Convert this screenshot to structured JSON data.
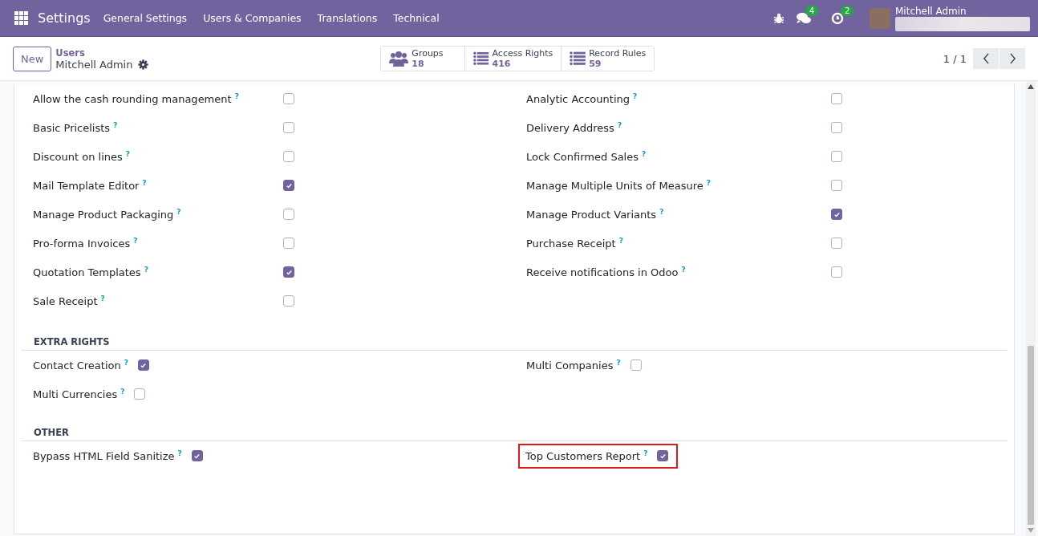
{
  "navbar": {
    "app": "Settings",
    "menu": [
      "General Settings",
      "Users & Companies",
      "Translations",
      "Technical"
    ],
    "messages_badge": "4",
    "activities_badge": "2",
    "user": "Mitchell Admin"
  },
  "control_panel": {
    "new_button": "New",
    "breadcrumb": "Users",
    "record": "Mitchell Admin",
    "pager": "1 / 1",
    "smart_buttons": [
      {
        "kind": "groups",
        "label": "Groups",
        "count": "18"
      },
      {
        "kind": "list",
        "label": "Access Rights",
        "count": "416"
      },
      {
        "kind": "list",
        "label": "Record Rules",
        "count": "59"
      }
    ]
  },
  "sections": [
    {
      "kind": "wide",
      "columns": [
        [
          {
            "label": "Allow the cash rounding management",
            "help": "?",
            "checked": false,
            "highlighted": false
          },
          {
            "label": "Basic Pricelists",
            "help": "?",
            "checked": false,
            "highlighted": false
          },
          {
            "label": "Discount on lines",
            "help": "?",
            "checked": false,
            "highlighted": false
          },
          {
            "label": "Mail Template Editor",
            "help": "?",
            "checked": true,
            "highlighted": false
          },
          {
            "label": "Manage Product Packaging",
            "help": "?",
            "checked": false,
            "highlighted": false
          },
          {
            "label": "Pro-forma Invoices",
            "help": "?",
            "checked": false,
            "highlighted": false
          },
          {
            "label": "Quotation Templates",
            "help": "?",
            "checked": true,
            "highlighted": false
          },
          {
            "label": "Sale Receipt",
            "help": "?",
            "checked": false,
            "highlighted": false
          }
        ],
        [
          {
            "label": "Analytic Accounting",
            "help": "?",
            "checked": false,
            "highlighted": false
          },
          {
            "label": "Delivery Address",
            "help": "?",
            "checked": false,
            "highlighted": false
          },
          {
            "label": "Lock Confirmed Sales",
            "help": "?",
            "checked": false,
            "highlighted": false
          },
          {
            "label": "Manage Multiple Units of Measure",
            "help": "?",
            "checked": false,
            "highlighted": false
          },
          {
            "label": "Manage Product Variants",
            "help": "?",
            "checked": true,
            "highlighted": false
          },
          {
            "label": "Purchase Receipt",
            "help": "?",
            "checked": false,
            "highlighted": false
          },
          {
            "label": "Receive notifications in Odoo",
            "help": "?",
            "checked": false,
            "highlighted": false
          }
        ]
      ]
    },
    {
      "kind": "inline",
      "title": "EXTRA RIGHTS",
      "columns": [
        [
          {
            "label": "Contact Creation",
            "help": "?",
            "checked": true,
            "highlighted": false
          },
          {
            "label": "Multi Currencies",
            "help": "?",
            "checked": false,
            "highlighted": false
          }
        ],
        [
          {
            "label": "Multi Companies",
            "help": "?",
            "checked": false,
            "highlighted": false
          }
        ]
      ]
    },
    {
      "kind": "inline",
      "title": "OTHER",
      "columns": [
        [
          {
            "label": "Bypass HTML Field Sanitize",
            "help": "?",
            "checked": true,
            "highlighted": false
          }
        ],
        [
          {
            "label": "Top Customers Report",
            "help": "?",
            "checked": true,
            "highlighted": true
          }
        ]
      ]
    }
  ]
}
